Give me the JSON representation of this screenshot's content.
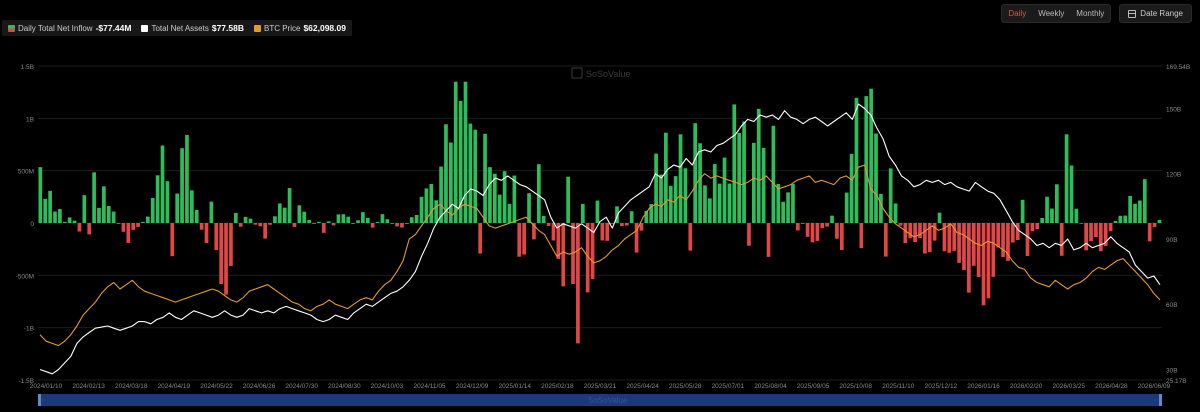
{
  "toolbar": {
    "periods": [
      "Daily",
      "Weekly",
      "Monthly"
    ],
    "active_period": "Daily",
    "date_range_label": "Date Range"
  },
  "legend": [
    {
      "label": "Daily Total Net Inflow",
      "value": "-$77.44M",
      "color": "#2ebd5b"
    },
    {
      "label": "Total Net Assets",
      "value": "$77.58B",
      "color": "#ffffff"
    },
    {
      "label": "BTC Price",
      "value": "$62,098.09",
      "color": "#e39a2e"
    }
  ],
  "watermark": "SoSoValue",
  "colors": {
    "positive": "#2ebd5b",
    "negative": "#e24646",
    "assets": "#ffffff",
    "price": "#e39a2e",
    "navigator": "#1b3a7a"
  },
  "chart_data": {
    "type": "bar",
    "x_ticks": [
      "2024/01/10",
      "2024/02/13",
      "2024/03/18",
      "2024/04/19",
      "2024/05/22",
      "2024/06/26",
      "2024/07/30",
      "2024/08/30",
      "2024/10/03",
      "2024/11/05",
      "2024/12/09",
      "2025/01/14",
      "2025/02/18",
      "2025/03/21",
      "2025/04/24",
      "2025/05/28",
      "2025/07/01",
      "2025/08/04",
      "2025/09/05",
      "2025/10/08",
      "2025/11/10",
      "2025/12/12",
      "2026/01/16",
      "2026/02/20",
      "2026/03/25",
      "2026/04/28",
      "2026/06/09"
    ],
    "left_axis": {
      "ticks": [
        "1.5B",
        "1B",
        "500M",
        "0",
        "-500M",
        "-1B",
        "-1.5B"
      ],
      "values": [
        1.5,
        1,
        0.5,
        0,
        -0.5,
        -1,
        -1.5
      ],
      "ylim": [
        -1.5,
        1.5
      ]
    },
    "right_axis": {
      "ticks": [
        "169.54B",
        "150B",
        "120B",
        "90B",
        "60B",
        "30B",
        "25.17B"
      ],
      "values": [
        169.54,
        150,
        120,
        90,
        60,
        30,
        25.17
      ],
      "ylim": [
        25.17,
        169.54
      ]
    },
    "series": [
      {
        "name": "Daily Total Net Inflow",
        "axis": "left",
        "type": "bar",
        "anchors": [
          [
            0,
            0.6
          ],
          [
            6,
            -0.1
          ],
          [
            10,
            0.4
          ],
          [
            14,
            0.2
          ],
          [
            18,
            -0.2
          ],
          [
            22,
            0.1
          ],
          [
            26,
            0.8
          ],
          [
            30,
            0.6
          ],
          [
            34,
            -0.3
          ],
          [
            38,
            -0.5
          ],
          [
            42,
            0.1
          ],
          [
            46,
            -0.15
          ],
          [
            50,
            0.3
          ],
          [
            54,
            0.1
          ],
          [
            58,
            -0.1
          ],
          [
            62,
            0.2
          ],
          [
            66,
            -0.2
          ],
          [
            70,
            0.1
          ],
          [
            74,
            -0.1
          ],
          [
            78,
            0.3
          ],
          [
            82,
            0.5
          ],
          [
            86,
            1.3
          ],
          [
            90,
            0.7
          ],
          [
            94,
            0.3
          ],
          [
            98,
            0.6
          ],
          [
            102,
            0.4
          ],
          [
            106,
            -0.5
          ],
          [
            110,
            -0.9
          ],
          [
            114,
            -0.6
          ],
          [
            118,
            0.2
          ],
          [
            122,
            -0.3
          ],
          [
            126,
            0.5
          ],
          [
            130,
            0.9
          ],
          [
            134,
            0.7
          ],
          [
            138,
            0.4
          ],
          [
            142,
            0.9
          ],
          [
            146,
            1.0
          ],
          [
            150,
            0.7
          ],
          [
            154,
            0.3
          ],
          [
            158,
            -0.3
          ],
          [
            162,
            0.2
          ],
          [
            166,
            0.8
          ],
          [
            170,
            1.0
          ],
          [
            174,
            0.5
          ],
          [
            178,
            -0.4
          ],
          [
            182,
            -0.3
          ],
          [
            186,
            -0.6
          ],
          [
            190,
            -0.5
          ],
          [
            194,
            -0.7
          ],
          [
            198,
            -0.3
          ],
          [
            202,
            -0.4
          ],
          [
            206,
            0.3
          ],
          [
            210,
            0.6
          ],
          [
            214,
            -0.2
          ],
          [
            218,
            -0.3
          ],
          [
            222,
            0.2
          ],
          [
            226,
            0.4
          ],
          [
            230,
            -0.1
          ]
        ]
      },
      {
        "name": "Total Net Assets",
        "axis": "right",
        "type": "line",
        "values": [
          30,
          29,
          28,
          30,
          33,
          36,
          42,
          45,
          47,
          49,
          49.5,
          50,
          49,
          48,
          49,
          50,
          52,
          52,
          51,
          53,
          54,
          56,
          54,
          53,
          55,
          57,
          56,
          55,
          54,
          55,
          57,
          55,
          54,
          55,
          58,
          57,
          56,
          57,
          56,
          58,
          59,
          58,
          57,
          56,
          55,
          53,
          52,
          53,
          55,
          54,
          53,
          56,
          58,
          60,
          59,
          61,
          63,
          65,
          66,
          68,
          71,
          75,
          82,
          88,
          95,
          100,
          103,
          106,
          104,
          110,
          113,
          112,
          110,
          115,
          118,
          117,
          119,
          117,
          115,
          114,
          112,
          110,
          108,
          100,
          95,
          97,
          96,
          95,
          97,
          95,
          93,
          98,
          100,
          95,
          102,
          105,
          108,
          110,
          112,
          114,
          120,
          118,
          122,
          124,
          123,
          127,
          124,
          130,
          131,
          130,
          133,
          134,
          136,
          138,
          142,
          145,
          144,
          147,
          146,
          147,
          145,
          149,
          146,
          145,
          143,
          145,
          146,
          144,
          142,
          144,
          146,
          148,
          145,
          152,
          150,
          147,
          141,
          136,
          128,
          124,
          119,
          117,
          114,
          115,
          117,
          116,
          117,
          115,
          116,
          114,
          113,
          112,
          116,
          114,
          112,
          111,
          108,
          103,
          98,
          94,
          92,
          90,
          87,
          88,
          86,
          88,
          87,
          90,
          85,
          86,
          88,
          86,
          87,
          88,
          91,
          88,
          86,
          84,
          78,
          75,
          72,
          73,
          69
        ]
      },
      {
        "name": "BTC Price",
        "axis": "right",
        "type": "line",
        "values": [
          46,
          43,
          42,
          41,
          43,
          46,
          50,
          55,
          58,
          61,
          65,
          68,
          70,
          67,
          69,
          71,
          68,
          66,
          65,
          64,
          63,
          62,
          61,
          62,
          63,
          64,
          65,
          66,
          67,
          66,
          64,
          62,
          61,
          63,
          66,
          67,
          68,
          69,
          67,
          65,
          63,
          61,
          60,
          58,
          57,
          59,
          60,
          62,
          60,
          59,
          58,
          60,
          62,
          63,
          62,
          66,
          69,
          71,
          75,
          80,
          90,
          92,
          96,
          100,
          104,
          106,
          103,
          101,
          104,
          106,
          105,
          104,
          100,
          96,
          95,
          96,
          97,
          98,
          99,
          100,
          97,
          94,
          92,
          87,
          82,
          84,
          83,
          84,
          86,
          82,
          79,
          80,
          82,
          85,
          87,
          90,
          92,
          94,
          100,
          104,
          106,
          105,
          108,
          107,
          110,
          108,
          112,
          117,
          120,
          118,
          119,
          118,
          117,
          116,
          115,
          116,
          118,
          117,
          119,
          116,
          113,
          114,
          115,
          117,
          118,
          119,
          116,
          117,
          116,
          115,
          118,
          119,
          117,
          123,
          124,
          113,
          110,
          104,
          100,
          97,
          95,
          93,
          91,
          92,
          94,
          96,
          94,
          95,
          97,
          93,
          92,
          90,
          88,
          87,
          89,
          88,
          86,
          84,
          80,
          77,
          76,
          72,
          70,
          69,
          68,
          71,
          69,
          67,
          69,
          70,
          72,
          75,
          77,
          76,
          78,
          80,
          81,
          78,
          75,
          72,
          69,
          65,
          62
        ]
      }
    ]
  }
}
